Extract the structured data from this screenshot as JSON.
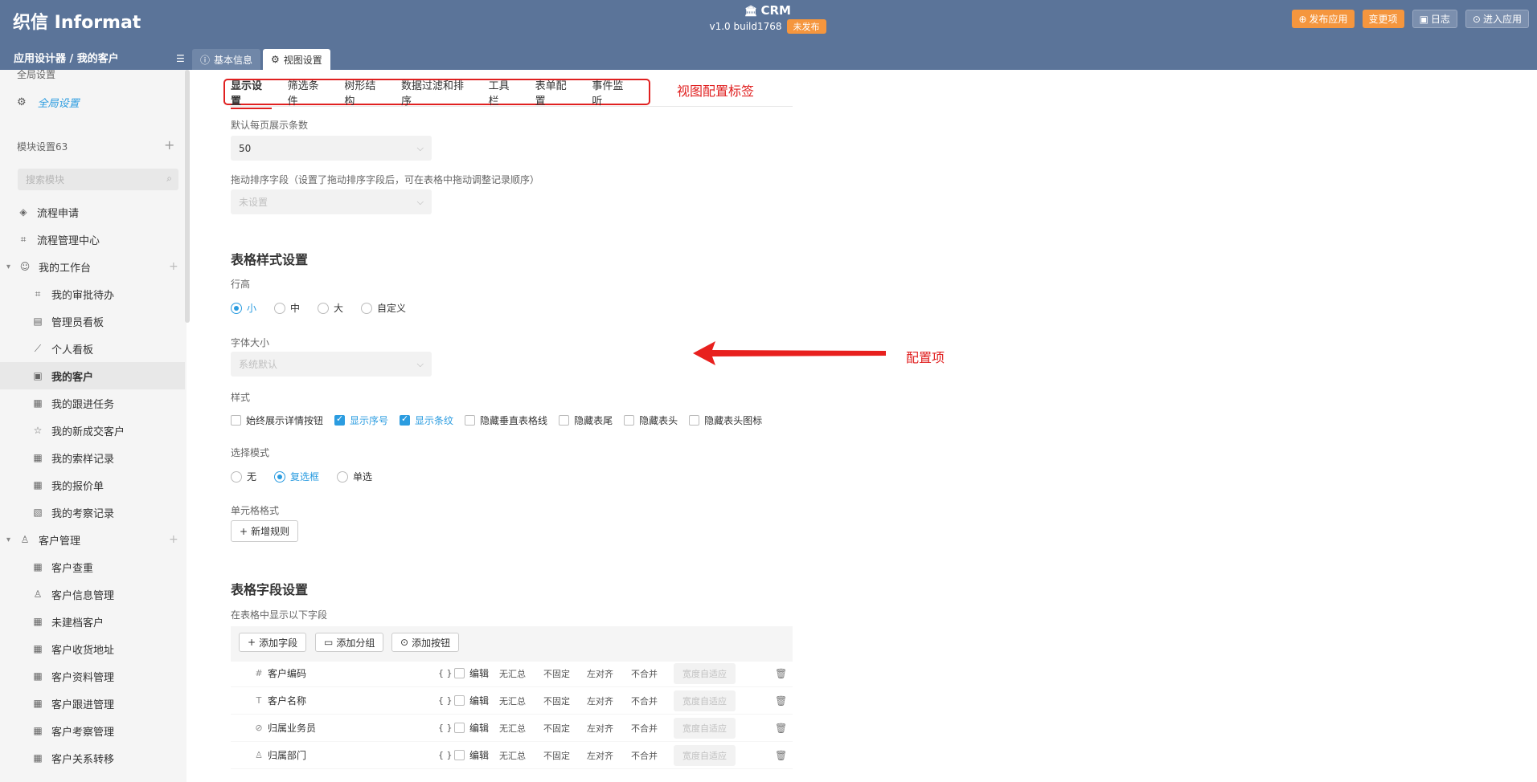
{
  "header": {
    "logo": "织信 Informat",
    "app_name": "CRM",
    "app_version": "v1.0 build1768",
    "unpublished_badge": "未发布",
    "actions": [
      {
        "label": "发布应用",
        "icon": "upload-icon"
      },
      {
        "label": "变更项",
        "icon": ""
      },
      {
        "label": "日志",
        "icon": "log-icon"
      },
      {
        "label": "进入应用",
        "icon": "enter-icon"
      }
    ],
    "breadcrumb": "应用设计器 / 我的客户",
    "tabs": [
      {
        "label": "基本信息",
        "icon": "info-icon",
        "active": false
      },
      {
        "label": "视图设置",
        "icon": "gear-icon",
        "active": true
      }
    ]
  },
  "sidebar": {
    "global_title": "全局设置",
    "global_item": "全局设置",
    "module_title": "模块设置63",
    "search_placeholder": "搜索模块",
    "items": [
      {
        "label": "流程申请",
        "icon": "layers-icon",
        "level": 1
      },
      {
        "label": "流程管理中心",
        "icon": "flow-icon",
        "level": 1
      },
      {
        "label": "我的工作台",
        "icon": "smile-icon",
        "level": 0
      },
      {
        "label": "我的审批待办",
        "icon": "flow-icon",
        "level": 2
      },
      {
        "label": "管理员看板",
        "icon": "chart-icon",
        "level": 2
      },
      {
        "label": "个人看板",
        "icon": "line-chart-icon",
        "level": 2
      },
      {
        "label": "我的客户",
        "icon": "card-icon",
        "level": 2,
        "selected": true
      },
      {
        "label": "我的跟进任务",
        "icon": "table-icon",
        "level": 2
      },
      {
        "label": "我的新成交客户",
        "icon": "star-icon",
        "level": 2
      },
      {
        "label": "我的索样记录",
        "icon": "table-icon",
        "level": 2
      },
      {
        "label": "我的报价单",
        "icon": "table-icon",
        "level": 2
      },
      {
        "label": "我的考察记录",
        "icon": "doc-icon",
        "level": 2
      },
      {
        "label": "客户管理",
        "icon": "user-icon",
        "level": 0
      },
      {
        "label": "客户查重",
        "icon": "table-icon",
        "level": 2
      },
      {
        "label": "客户信息管理",
        "icon": "user-icon",
        "level": 2
      },
      {
        "label": "未建档客户",
        "icon": "table-icon",
        "level": 2
      },
      {
        "label": "客户收货地址",
        "icon": "table-icon",
        "level": 2
      },
      {
        "label": "客户资料管理",
        "icon": "table-icon",
        "level": 2
      },
      {
        "label": "客户跟进管理",
        "icon": "table-icon",
        "level": 2
      },
      {
        "label": "客户考察管理",
        "icon": "table-icon",
        "level": 2
      },
      {
        "label": "客户关系转移",
        "icon": "table-icon",
        "level": 2
      }
    ]
  },
  "view_tabs": [
    "显示设置",
    "筛选条件",
    "树形结构",
    "数据过滤和排序",
    "工具栏",
    "表单配置",
    "事件监听"
  ],
  "annotations": {
    "tabs_note": "视图配置标签",
    "items_note": "配置项"
  },
  "display": {
    "page_size_label": "默认每页展示条数",
    "page_size_value": "50",
    "drag_label": "拖动排序字段（设置了拖动排序字段后，可在表格中拖动调整记录顺序）",
    "drag_value": "未设置",
    "style_section_title": "表格样式设置",
    "row_height_label": "行高",
    "row_heights": [
      {
        "label": "小",
        "checked": true
      },
      {
        "label": "中",
        "checked": false
      },
      {
        "label": "大",
        "checked": false
      },
      {
        "label": "自定义",
        "checked": false
      }
    ],
    "font_size_label": "字体大小",
    "font_size_value": "系统默认",
    "style_label": "样式",
    "style_options": [
      {
        "label": "始终展示详情按钮",
        "checked": false
      },
      {
        "label": "显示序号",
        "checked": true
      },
      {
        "label": "显示条纹",
        "checked": true
      },
      {
        "label": "隐藏垂直表格线",
        "checked": false
      },
      {
        "label": "隐藏表尾",
        "checked": false
      },
      {
        "label": "隐藏表头",
        "checked": false
      },
      {
        "label": "隐藏表头图标",
        "checked": false
      }
    ],
    "select_mode_label": "选择模式",
    "select_modes": [
      {
        "label": "无",
        "checked": false
      },
      {
        "label": "复选框",
        "checked": true
      },
      {
        "label": "单选",
        "checked": false
      }
    ],
    "cell_format_label": "单元格格式",
    "add_rule_button": "新增规则"
  },
  "fields": {
    "section_title": "表格字段设置",
    "subtitle": "在表格中显示以下字段",
    "toolbar": [
      {
        "label": "添加字段",
        "icon": "plus-icon"
      },
      {
        "label": "添加分组",
        "icon": "folder-icon"
      },
      {
        "label": "添加按钮",
        "icon": "circle-icon"
      }
    ],
    "rows": [
      {
        "icon": "#",
        "name": "客户编码",
        "brace": "{ }",
        "edit": "编辑",
        "summary": "无汇总",
        "fixed": "不固定",
        "align": "左对齐",
        "merge": "不合并",
        "width": "宽度自适应"
      },
      {
        "icon": "T",
        "name": "客户名称",
        "brace": "{ }",
        "edit": "编辑",
        "summary": "无汇总",
        "fixed": "不固定",
        "align": "左对齐",
        "merge": "不合并",
        "width": "宽度自适应"
      },
      {
        "icon": "⊘",
        "name": "归属业务员",
        "brace": "{ }",
        "edit": "编辑",
        "summary": "无汇总",
        "fixed": "不固定",
        "align": "左对齐",
        "merge": "不合并",
        "width": "宽度自适应"
      },
      {
        "icon": "♙",
        "name": "归属部门",
        "brace": "{ }",
        "edit": "编辑",
        "summary": "无汇总",
        "fixed": "不固定",
        "align": "左对齐",
        "merge": "不合并",
        "width": "宽度自适应"
      }
    ]
  }
}
